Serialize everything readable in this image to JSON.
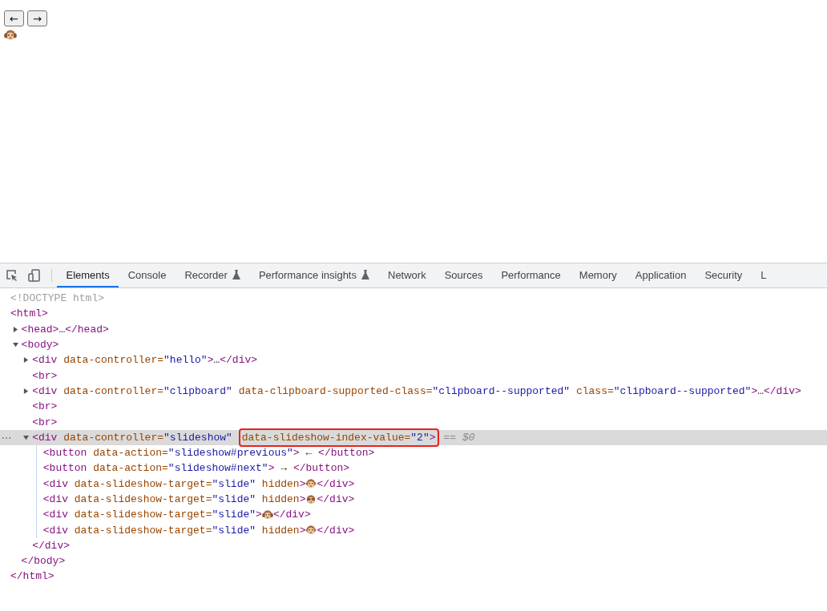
{
  "page": {
    "buttons": [
      {
        "label": "←"
      },
      {
        "label": "→"
      }
    ],
    "slide": {
      "kind": "ears-covered"
    }
  },
  "devtools": {
    "tabs": [
      {
        "label": "Elements",
        "selected": true,
        "experimental": false
      },
      {
        "label": "Console",
        "selected": false,
        "experimental": false
      },
      {
        "label": "Recorder",
        "selected": false,
        "experimental": true
      },
      {
        "label": "Performance insights",
        "selected": false,
        "experimental": true
      },
      {
        "label": "Network",
        "selected": false,
        "experimental": false
      },
      {
        "label": "Sources",
        "selected": false,
        "experimental": false
      },
      {
        "label": "Performance",
        "selected": false,
        "experimental": false
      },
      {
        "label": "Memory",
        "selected": false,
        "experimental": false
      },
      {
        "label": "Application",
        "selected": false,
        "experimental": false
      },
      {
        "label": "Security",
        "selected": false,
        "experimental": false
      },
      {
        "label": "L",
        "selected": false,
        "experimental": false
      }
    ],
    "dom": [
      {
        "selected": false,
        "tokens": [
          {
            "kind": "doctype",
            "t": "<!DOCTYPE html>"
          }
        ]
      },
      {
        "selected": false,
        "tokens": [
          {
            "kind": "tag",
            "t": "<html>"
          }
        ],
        "closing": [
          {
            "kind": "tag",
            "t": "</html>"
          }
        ],
        "children": [
          {
            "selected": false,
            "expanded": false,
            "tokens": [
              {
                "kind": "tag",
                "t": "<head>"
              },
              {
                "kind": "text",
                "t": "…"
              },
              {
                "kind": "tag",
                "t": "</head>"
              }
            ]
          },
          {
            "selected": false,
            "expanded": true,
            "tokens": [
              {
                "kind": "tag",
                "t": "<body>"
              }
            ],
            "closing": [
              {
                "kind": "tag",
                "t": "</body>"
              }
            ],
            "children": [
              {
                "selected": false,
                "expanded": false,
                "tokens": [
                  {
                    "kind": "tag",
                    "t": "<div"
                  },
                  {
                    "kind": "attr",
                    "t": " data-controller="
                  },
                  {
                    "kind": "value",
                    "t": "\"hello\""
                  },
                  {
                    "kind": "tag",
                    "t": ">"
                  },
                  {
                    "kind": "text",
                    "t": "…"
                  },
                  {
                    "kind": "tag",
                    "t": "</div>"
                  }
                ]
              },
              {
                "selected": false,
                "tokens": [
                  {
                    "kind": "tag",
                    "t": "<br>"
                  }
                ]
              },
              {
                "selected": false,
                "expanded": false,
                "tokens": [
                  {
                    "kind": "tag",
                    "t": "<div"
                  },
                  {
                    "kind": "attr",
                    "t": " data-controller="
                  },
                  {
                    "kind": "value",
                    "t": "\"clipboard\""
                  },
                  {
                    "kind": "attr",
                    "t": " data-clipboard-supported-class="
                  },
                  {
                    "kind": "value",
                    "t": "\"clipboard--supported\""
                  },
                  {
                    "kind": "attr",
                    "t": " class="
                  },
                  {
                    "kind": "value",
                    "t": "\"clipboard--supported\""
                  },
                  {
                    "kind": "tag",
                    "t": ">"
                  },
                  {
                    "kind": "text",
                    "t": "…"
                  },
                  {
                    "kind": "tag",
                    "t": "</div>"
                  }
                ]
              },
              {
                "selected": false,
                "tokens": [
                  {
                    "kind": "tag",
                    "t": "<br>"
                  }
                ]
              },
              {
                "selected": false,
                "tokens": [
                  {
                    "kind": "tag",
                    "t": "<br>"
                  }
                ]
              },
              {
                "selected": true,
                "expanded": true,
                "tokens": [
                  {
                    "kind": "tag",
                    "t": "<div"
                  },
                  {
                    "kind": "attr",
                    "t": " data-controller="
                  },
                  {
                    "kind": "value",
                    "t": "\"slideshow\""
                  },
                  {
                    "kind": "group",
                    "highlighted": true,
                    "parts": [
                      {
                        "kind": "attr",
                        "t": "data-slideshow-index-value="
                      },
                      {
                        "kind": "value",
                        "t": "\"2\""
                      },
                      {
                        "kind": "tag",
                        "t": ">"
                      }
                    ]
                  },
                  {
                    "kind": "ref",
                    "t": "== $0"
                  }
                ],
                "closing": [
                  {
                    "kind": "tag",
                    "t": "</div>"
                  }
                ],
                "children": [
                  {
                    "selected": false,
                    "tokens": [
                      {
                        "kind": "tag",
                        "t": "<button"
                      },
                      {
                        "kind": "attr",
                        "t": " data-action="
                      },
                      {
                        "kind": "value",
                        "t": "\"slideshow#previous\""
                      },
                      {
                        "kind": "tag",
                        "t": ">"
                      },
                      {
                        "kind": "text",
                        "t": " ← "
                      },
                      {
                        "kind": "tag",
                        "t": "</button>"
                      }
                    ]
                  },
                  {
                    "selected": false,
                    "tokens": [
                      {
                        "kind": "tag",
                        "t": "<button"
                      },
                      {
                        "kind": "attr",
                        "t": " data-action="
                      },
                      {
                        "kind": "value",
                        "t": "\"slideshow#next\""
                      },
                      {
                        "kind": "tag",
                        "t": ">"
                      },
                      {
                        "kind": "text",
                        "t": " → "
                      },
                      {
                        "kind": "tag",
                        "t": "</button>"
                      }
                    ]
                  },
                  {
                    "selected": false,
                    "tokens": [
                      {
                        "kind": "tag",
                        "t": "<div"
                      },
                      {
                        "kind": "attr",
                        "t": " data-slideshow-target="
                      },
                      {
                        "kind": "value",
                        "t": "\"slide\""
                      },
                      {
                        "kind": "attr",
                        "t": " hidden"
                      },
                      {
                        "kind": "tag",
                        "t": ">"
                      },
                      {
                        "kind": "face"
                      },
                      {
                        "kind": "tag",
                        "t": "</div>"
                      }
                    ]
                  },
                  {
                    "selected": false,
                    "tokens": [
                      {
                        "kind": "tag",
                        "t": "<div"
                      },
                      {
                        "kind": "attr",
                        "t": " data-slideshow-target="
                      },
                      {
                        "kind": "value",
                        "t": "\"slide\""
                      },
                      {
                        "kind": "attr",
                        "t": " hidden"
                      },
                      {
                        "kind": "tag",
                        "t": ">"
                      },
                      {
                        "kind": "eyes-covered"
                      },
                      {
                        "kind": "tag",
                        "t": "</div>"
                      }
                    ]
                  },
                  {
                    "selected": false,
                    "tokens": [
                      {
                        "kind": "tag",
                        "t": "<div"
                      },
                      {
                        "kind": "attr",
                        "t": " data-slideshow-target="
                      },
                      {
                        "kind": "value",
                        "t": "\"slide\""
                      },
                      {
                        "kind": "tag",
                        "t": ">"
                      },
                      {
                        "kind": "ears-covered"
                      },
                      {
                        "kind": "tag",
                        "t": "</div>"
                      }
                    ]
                  },
                  {
                    "selected": false,
                    "tokens": [
                      {
                        "kind": "tag",
                        "t": "<div"
                      },
                      {
                        "kind": "attr",
                        "t": " data-slideshow-target="
                      },
                      {
                        "kind": "value",
                        "t": "\"slide\""
                      },
                      {
                        "kind": "attr",
                        "t": " hidden"
                      },
                      {
                        "kind": "tag",
                        "t": ">"
                      },
                      {
                        "kind": "face"
                      },
                      {
                        "kind": "tag",
                        "t": "</div>"
                      }
                    ]
                  }
                ]
              }
            ]
          }
        ]
      }
    ]
  }
}
